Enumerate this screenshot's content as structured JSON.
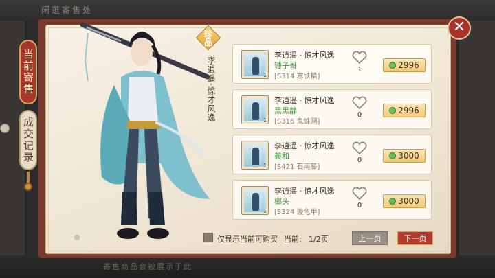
{
  "background": {
    "title": "闲逛寄售处",
    "bottom_text": "寄售商品会被展示于此"
  },
  "side_tabs": [
    {
      "label": "当前寄售",
      "active": true
    },
    {
      "label": "成交记录",
      "active": false
    }
  ],
  "badge": "珍品",
  "costume_name": "李逍遥·惊才风逸",
  "listings": [
    {
      "title": "李逍遥 · 惊才风逸",
      "seller": "锤子哥",
      "server": "[S314 寒铁精]",
      "likes": "1",
      "price": "2996",
      "qty": "1"
    },
    {
      "title": "李逍遥 · 惊才风逸",
      "seller": "黑黑静",
      "server": "[S316 鬼蛛网]",
      "likes": "0",
      "price": "2996",
      "qty": "1"
    },
    {
      "title": "李逍遥 · 惊才风逸",
      "seller": "義和",
      "server": "[S421 石南藤]",
      "likes": "0",
      "price": "3000",
      "qty": "1"
    },
    {
      "title": "李逍遥 · 惊才风逸",
      "seller": "榔头",
      "server": "[S324 璇龟甲]",
      "likes": "0",
      "price": "3000",
      "qty": "1"
    }
  ],
  "filter_label": "仅显示当前可购买",
  "page": {
    "label": "当前:",
    "value": "1/2页"
  },
  "prev_label": "上一页",
  "next_label": "下一页",
  "colors": {
    "accent": "#a9322a",
    "seller": "#3c9a3a",
    "price_bg": "#efc97a",
    "parchment": "#f3ecde"
  },
  "icons": {
    "close": "close-icon",
    "like": "heart-icon",
    "currency": "coin-icon"
  }
}
